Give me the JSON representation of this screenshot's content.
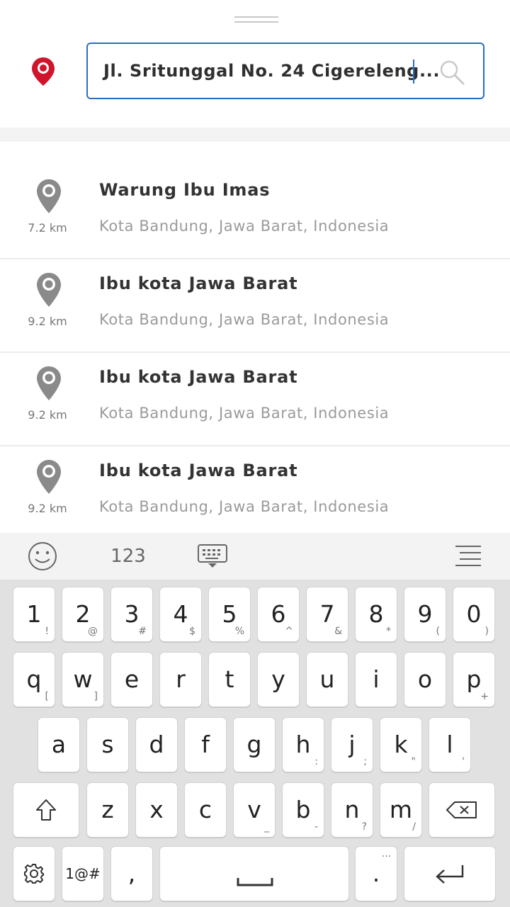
{
  "search": {
    "value": "Jl. Sritunggal No. 24 Cigereleng..."
  },
  "results": [
    {
      "title": "Warung Ibu Imas",
      "subtitle": "Kota Bandung, Jawa Barat, Indonesia",
      "distance": "7.2 km"
    },
    {
      "title": "Ibu kota Jawa Barat",
      "subtitle": "Kota Bandung, Jawa Barat, Indonesia",
      "distance": "9.2 km"
    },
    {
      "title": "Ibu kota Jawa Barat",
      "subtitle": "Kota Bandung, Jawa Barat, Indonesia",
      "distance": "9.2 km"
    },
    {
      "title": "Ibu kota Jawa Barat",
      "subtitle": "Kota Bandung, Jawa Barat, Indonesia",
      "distance": "9.2 km"
    }
  ],
  "keyboard": {
    "toolbar": {
      "numbers_label": "123"
    },
    "row1": [
      {
        "main": "1",
        "sec": "!"
      },
      {
        "main": "2",
        "sec": "@"
      },
      {
        "main": "3",
        "sec": "#"
      },
      {
        "main": "4",
        "sec": "$"
      },
      {
        "main": "5",
        "sec": "%"
      },
      {
        "main": "6",
        "sec": "^"
      },
      {
        "main": "7",
        "sec": "&"
      },
      {
        "main": "8",
        "sec": "*"
      },
      {
        "main": "9",
        "sec": "("
      },
      {
        "main": "0",
        "sec": ")"
      }
    ],
    "row2": [
      {
        "main": "q",
        "sec": "["
      },
      {
        "main": "w",
        "sec": "]"
      },
      {
        "main": "e",
        "sec": ""
      },
      {
        "main": "r",
        "sec": ""
      },
      {
        "main": "t",
        "sec": ""
      },
      {
        "main": "y",
        "sec": ""
      },
      {
        "main": "u",
        "sec": ""
      },
      {
        "main": "i",
        "sec": ""
      },
      {
        "main": "o",
        "sec": ""
      },
      {
        "main": "p",
        "sec": "+"
      }
    ],
    "row3": [
      {
        "main": "a",
        "sec": ""
      },
      {
        "main": "s",
        "sec": ""
      },
      {
        "main": "d",
        "sec": ""
      },
      {
        "main": "f",
        "sec": ""
      },
      {
        "main": "g",
        "sec": ""
      },
      {
        "main": "h",
        "sec": ":"
      },
      {
        "main": "j",
        "sec": ";"
      },
      {
        "main": "k",
        "sec": "\""
      },
      {
        "main": "l",
        "sec": "'"
      }
    ],
    "row4": [
      {
        "main": "z",
        "sec": ""
      },
      {
        "main": "x",
        "sec": ""
      },
      {
        "main": "c",
        "sec": ""
      },
      {
        "main": "v",
        "sec": "_"
      },
      {
        "main": "b",
        "sec": "-"
      },
      {
        "main": "n",
        "sec": "?"
      },
      {
        "main": "m",
        "sec": "/"
      }
    ],
    "row5": {
      "symbols_label": "1@#",
      "comma": ",",
      "period": ".",
      "period_sec": "..."
    }
  },
  "icons": {
    "location_pin": "map-pin-icon",
    "search": "search-icon",
    "emoji": "emoji-icon",
    "keyboard_hide": "keyboard-hide-icon",
    "menu": "menu-icon",
    "shift": "shift-icon",
    "backspace": "backspace-icon",
    "settings": "gear-icon",
    "enter": "enter-icon"
  },
  "colors": {
    "accent": "#2b6cc4",
    "pin_red": "#d0142c",
    "pin_gray": "#8a8a8a"
  }
}
